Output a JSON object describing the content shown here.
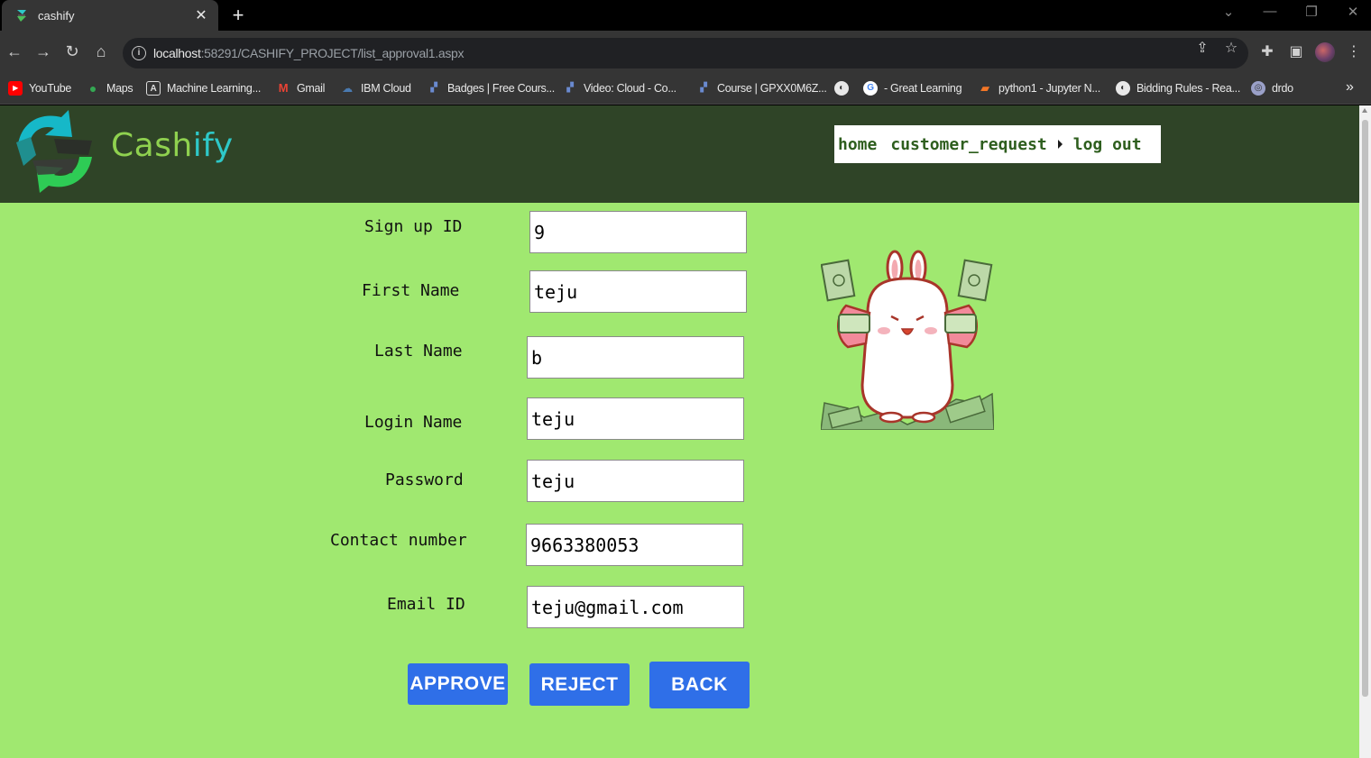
{
  "browser": {
    "tab_title": "cashify",
    "url_host": "localhost",
    "url_path": ":58291/CASHIFY_PROJECT/list_approval1.aspx",
    "bookmarks": [
      {
        "label": "YouTube",
        "icon": "youtube-icon",
        "color": "#ff0000"
      },
      {
        "label": "Maps",
        "icon": "maps-icon",
        "color": "#34a853"
      },
      {
        "label": "Machine Learning...",
        "icon": "ml-icon",
        "color": "#dddddd"
      },
      {
        "label": "Gmail",
        "icon": "gmail-icon",
        "color": "#ea4335"
      },
      {
        "label": "IBM Cloud",
        "icon": "cloud-icon",
        "color": "#4a7ab0"
      },
      {
        "label": "Badges | Free Cours...",
        "icon": "badge-icon",
        "color": "#6a8ad0"
      },
      {
        "label": "Video: Cloud  - Co...",
        "icon": "video-icon",
        "color": "#6a8ad0"
      },
      {
        "label": "Course | GPXX0M6Z...",
        "icon": "course-icon",
        "color": "#6a8ad0"
      },
      {
        "label": "",
        "icon": "globe-icon",
        "color": "#e8e8e8"
      },
      {
        "label": "- Great Learning",
        "icon": "google-icon",
        "color": "#ffffff"
      },
      {
        "label": "python1 - Jupyter N...",
        "icon": "jupyter-icon",
        "color": "#f37626"
      },
      {
        "label": "Bidding Rules - Rea...",
        "icon": "globe-icon",
        "color": "#e8e8e8"
      },
      {
        "label": "drdo",
        "icon": "drdo-icon",
        "color": "#9aa0c8"
      }
    ]
  },
  "header": {
    "logo_text_a": "Cash",
    "logo_text_b": "ify",
    "nav": {
      "home": "home",
      "customer_request": "customer_request",
      "logout": "log out"
    }
  },
  "form": {
    "fields": [
      {
        "label": "Sign up ID",
        "value": "9"
      },
      {
        "label": "First Name",
        "value": "teju"
      },
      {
        "label": "Last Name",
        "value": "b"
      },
      {
        "label": "Login Name",
        "value": "teju"
      },
      {
        "label": "Password",
        "value": "teju"
      },
      {
        "label": "Contact number",
        "value": "9663380053"
      },
      {
        "label": "Email ID",
        "value": "teju@gmail.com"
      }
    ],
    "buttons": {
      "approve": "APPROVE",
      "reject": "REJECT",
      "back": "BACK"
    }
  },
  "colors": {
    "page_bg": "#a0e870",
    "header_bg": "#2f4427",
    "button_bg": "#2f6fe8",
    "nav_text": "#2e5e1e"
  }
}
